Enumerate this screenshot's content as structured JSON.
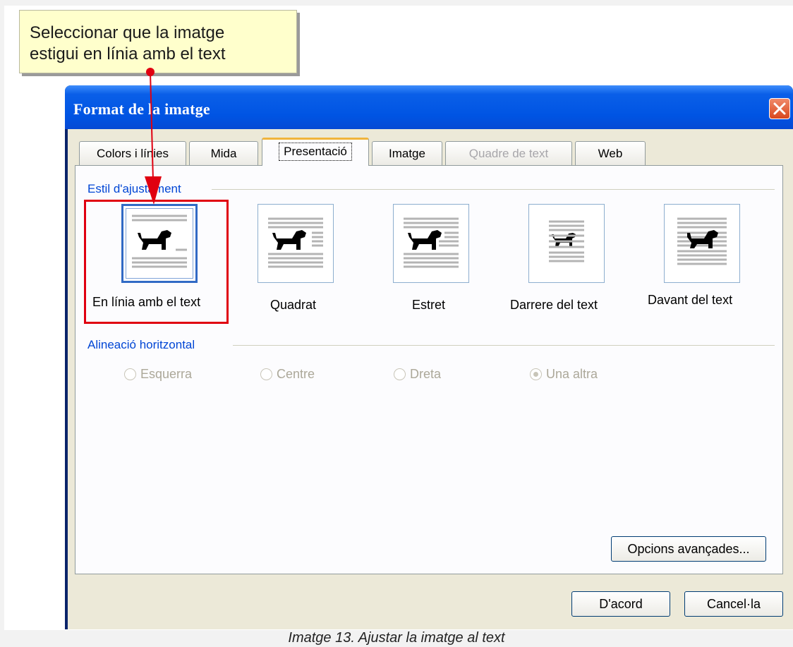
{
  "callout": {
    "line1": "Seleccionar que la imatge",
    "line2": "estigui en línia amb el text"
  },
  "dialog": {
    "title": "Format de la imatge",
    "tabs": [
      {
        "label": "Colors i línies",
        "state": "normal"
      },
      {
        "label": "Mida",
        "state": "normal"
      },
      {
        "label": "Presentació",
        "state": "active"
      },
      {
        "label": "Imatge",
        "state": "normal"
      },
      {
        "label": "Quadre de text",
        "state": "disabled"
      },
      {
        "label": "Web",
        "state": "normal"
      }
    ],
    "wrap_group_title": "Estil d'ajustament",
    "wrap_options": [
      {
        "label": "En línia amb el text",
        "selected": true
      },
      {
        "label": "Quadrat",
        "selected": false
      },
      {
        "label": "Estret",
        "selected": false
      },
      {
        "label": "Darrere del text",
        "selected": false
      },
      {
        "label": "Davant del text",
        "selected": false
      }
    ],
    "align_group_title": "Alineació horitzontal",
    "align_options": [
      {
        "label": "Esquerra",
        "checked": false
      },
      {
        "label": "Centre",
        "checked": false
      },
      {
        "label": "Dreta",
        "checked": false
      },
      {
        "label": "Una altra",
        "checked": true
      }
    ],
    "advanced_button": "Opcions avançades...",
    "ok_button": "D'acord",
    "cancel_button": "Cancel·la"
  },
  "caption": "Imatge 13. Ajustar la imatge al text",
  "colors": {
    "highlight": "#e00010",
    "titlebar": "#0054e3",
    "callout_bg": "#ffffcc"
  }
}
